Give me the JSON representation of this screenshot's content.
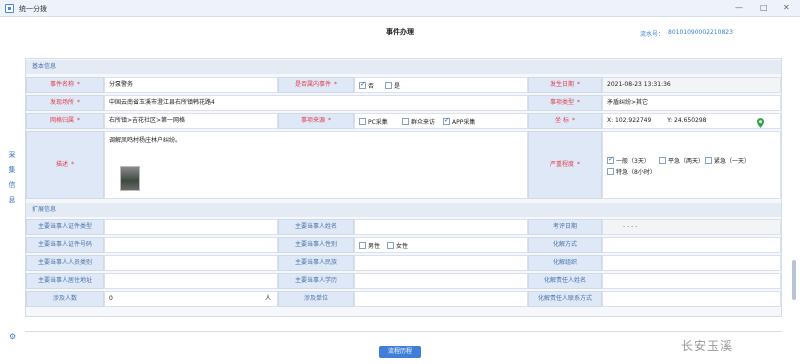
{
  "window": {
    "title": "统一分拨"
  },
  "header": {
    "doc_title": "事件办理",
    "serial_label": "流水号：",
    "serial_value": "80101090002210823"
  },
  "side_tab": [
    "采",
    "集",
    "信",
    "息"
  ],
  "basic": {
    "section_title": "基本信息",
    "event_name_label": "事件名称",
    "event_name_value": "分泵警务",
    "in_area_label": "是否属内事件",
    "in_area_no": "否",
    "in_area_yes": "是",
    "occur_date_label": "发生日期",
    "occur_date_value": "2021-08-23  13:31:36",
    "location_label": "发现场所",
    "location_value": "中国云南省玉溪市澄江县右所镇韩花路4",
    "event_type_label": "事项类型",
    "event_type_value": "矛盾纠纷>其它",
    "grid_label": "网格归属",
    "grid_value": "右所镇>吉花社区>第一网格",
    "source_label": "事项来源",
    "source_pc": "PC采集",
    "source_mass": "群众来访",
    "source_app": "APP采集",
    "coord_label": "坐    标",
    "coord_x": "X: 102.922749",
    "coord_y": "Y: 24.650298",
    "desc_label": "描述",
    "desc_value": "调解凤鸣村杨庄林户纠纷。",
    "severity_label": "严重程度",
    "sev_normal": "一般（3天）",
    "sev_urgent": "平急（两天）",
    "sev_critical": "紧急（一天）",
    "sev_special": "特急（8小时）"
  },
  "extended": {
    "section_title": "扩展信息",
    "party_cert_type": "主要当事人证件类型",
    "party_name": "主要当事人姓名",
    "exam_date": "考评日期",
    "exam_date_value": "- -   - -",
    "party_cert_no": "主要当事人证件号码",
    "party_gender": "主要当事人性别",
    "gender_male": "男性",
    "gender_female": "女性",
    "resolve_method": "化解方式",
    "party_category": "主要当事人人员类别",
    "party_ethnic": "主要当事人民族",
    "resolve_org": "化解组织",
    "party_address": "主要当事人居住地址",
    "party_education": "主要当事人学历",
    "resolver_name": "化解责任人姓名",
    "involved_count": "涉及人数",
    "involved_count_value": "0",
    "involved_unit_suffix": "人",
    "involved_unit": "涉及单位",
    "resolver_contact": "化解责任人联系方式"
  },
  "footer": {
    "process_button": "流程历程",
    "watermark": "长安玉溪"
  },
  "colors": {
    "accent": "#3f7fd8",
    "label_bg": "#dfe8f6",
    "required": "#e0414d",
    "section_bg": "#e4ebf5"
  }
}
